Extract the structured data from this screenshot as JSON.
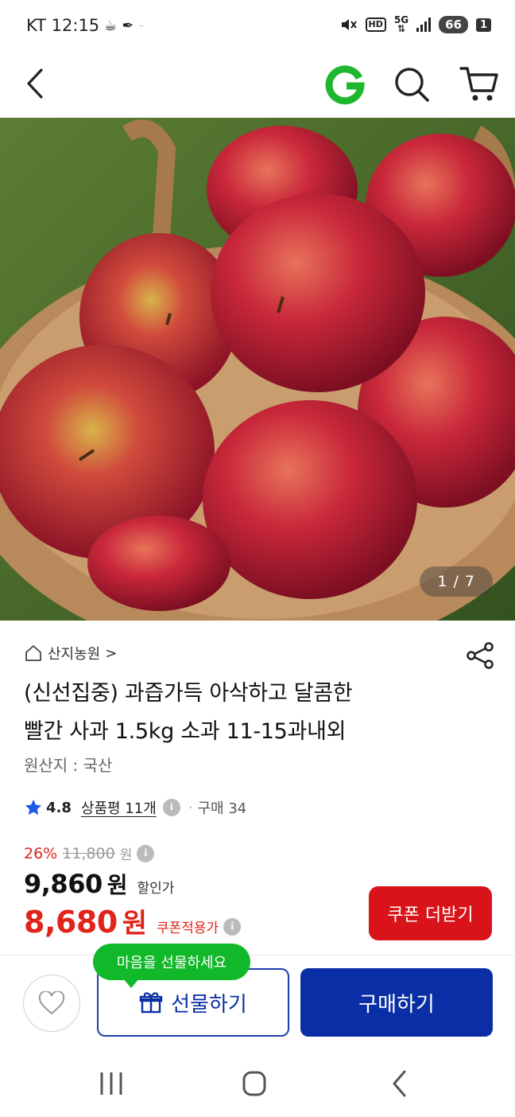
{
  "status_bar": {
    "carrier_time": "KT 12:15",
    "network": "5G",
    "battery": "66",
    "notification_count": "1",
    "hd_label": "HD"
  },
  "app_bar": {
    "back_icon": "chevron-left-icon",
    "brand_icon": "gmarket-g-logo",
    "search_icon": "search-icon",
    "cart_icon": "cart-icon",
    "brand_color": "#1fb72f"
  },
  "product_image": {
    "counter": "1 / 7"
  },
  "product": {
    "seller": "산지농원",
    "seller_chevron": ">",
    "title_line1": "(신선집중) 과즙가득 아삭하고 달콤한",
    "title_line2": "빨간 사과 1.5kg 소과 11-15과내외",
    "origin": "원산지 : 국산",
    "rating": "4.8",
    "review_label": "상품평 11개",
    "purchase_label": "구매 34"
  },
  "price": {
    "discount_rate": "26%",
    "original_price": "11,800",
    "original_unit": "원",
    "sale_price": "9,860",
    "sale_unit": "원",
    "sale_label": "할인가",
    "coupon_price": "8,680",
    "coupon_unit": "원",
    "coupon_label": "쿠폰적용가",
    "coupon_button": "쿠폰 더받기",
    "accent_color": "#e2231a"
  },
  "actions": {
    "tooltip": "마음을 선물하세요",
    "gift_button": "선물하기",
    "buy_button": "구매하기",
    "primary_color": "#0a2ea5"
  },
  "system_nav": {
    "recents_icon": "recents-icon",
    "home_icon": "home-icon",
    "back_icon": "back-icon"
  }
}
